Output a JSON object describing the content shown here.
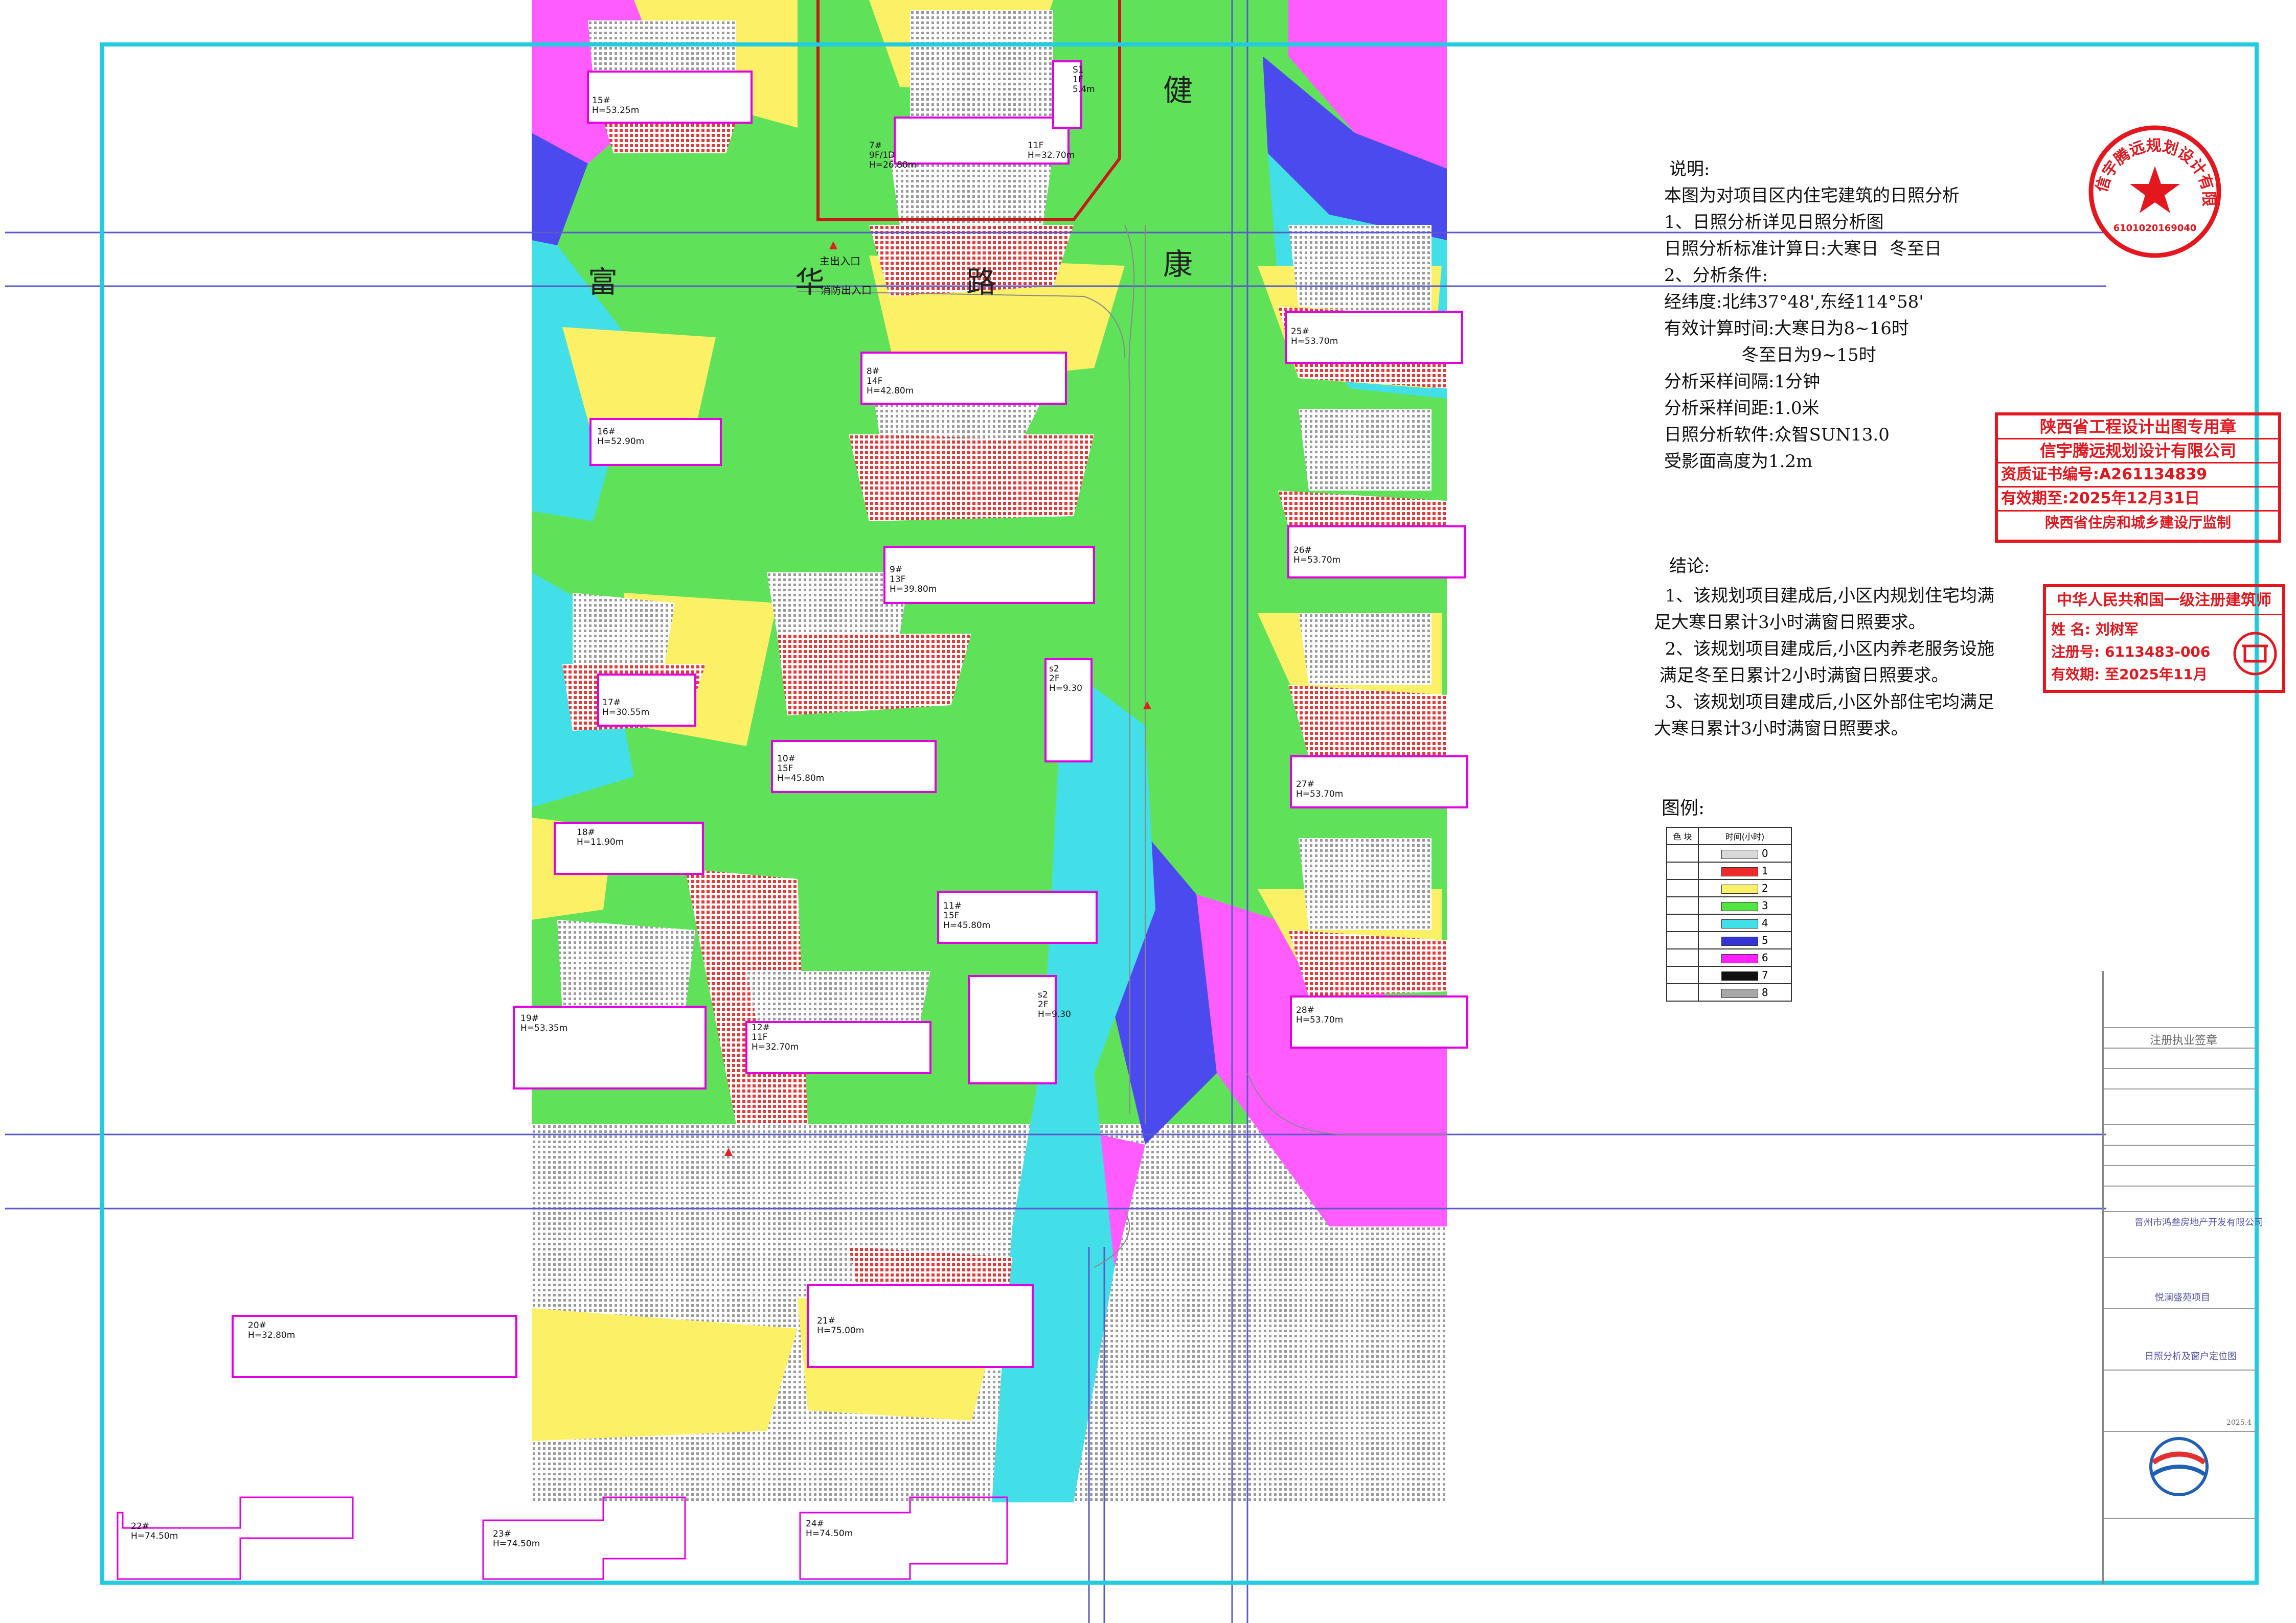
{
  "colors": {
    "frame": "#22cbe0",
    "red": "#ee2b2b",
    "yellow": "#fbf066",
    "green": "#52e542",
    "cyan": "#3fe0e8",
    "blue": "#4343ec",
    "magenta": "#ff1fff",
    "black": "#111111",
    "grey": "#bdbdbd",
    "stamp_red": "#e4161e"
  },
  "notes": {
    "heading": "说明:",
    "lines": [
      "本图为对项目区内住宅建筑的日照分析",
      "1、日照分析详见日照分析图",
      "日照分析标准计算日:大寒日  冬至日",
      "2、分析条件:",
      "经纬度:北纬37°48',东经114°58'",
      "有效计算时间:大寒日为8~16时",
      "              冬至日为9~15时",
      "分析采样间隔:1分钟",
      "分析采样间距:1.0米",
      "日照分析软件:众智SUN13.0",
      "受影面高度为1.2m"
    ]
  },
  "conclusion": {
    "heading": "结论:",
    "lines": [
      "  1、该规划项目建成后,小区内规划住宅均满",
      "足大寒日累计3小时满窗日照要求。",
      "  2、该规划项目建成后,小区内养老服务设施",
      " 满足冬至日累计2小时满窗日照要求。",
      "  3、该规划项目建成后,小区外部住宅均满足",
      "大寒日累计3小时满窗日照要求。"
    ]
  },
  "legend": {
    "title": "图例:",
    "header_color": "色 块",
    "header_time": "时间(小时)",
    "rows": [
      {
        "label": "0",
        "color": "#d9d9d9"
      },
      {
        "label": "1",
        "color": "#ee2b2b"
      },
      {
        "label": "2",
        "color": "#fbf066"
      },
      {
        "label": "3",
        "color": "#52e542"
      },
      {
        "label": "4",
        "color": "#3fe0e8"
      },
      {
        "label": "5",
        "color": "#3434d6"
      },
      {
        "label": "6",
        "color": "#ff1fff"
      },
      {
        "label": "7",
        "color": "#111111"
      },
      {
        "label": "8",
        "color": "#a8a8a8"
      }
    ]
  },
  "roads": {
    "fuhua": [
      "富",
      "华",
      "路"
    ],
    "jiankang": [
      "健",
      "康"
    ]
  },
  "entrances": {
    "main": "主出入口",
    "fire": "消防出入口"
  },
  "buildings": [
    {
      "name": "15#",
      "height": "H=53.25m"
    },
    {
      "name": "16#",
      "height": "H=52.90m"
    },
    {
      "name": "17#",
      "height": "H=30.55m"
    },
    {
      "name": "18#",
      "height": "H=11.90m"
    },
    {
      "name": "19#",
      "height": "H=53.35m"
    },
    {
      "name": "20#",
      "height": "H=32.80m"
    },
    {
      "name": "21#",
      "height": "H=75.00m"
    },
    {
      "name": "22#",
      "height": "H=74.50m"
    },
    {
      "name": "23#",
      "height": "H=74.50m"
    },
    {
      "name": "24#",
      "height": "H=74.50m"
    },
    {
      "name": "25#",
      "height": "H=53.70m"
    },
    {
      "name": "26#",
      "height": "H=53.70m"
    },
    {
      "name": "27#",
      "height": "H=53.70m"
    },
    {
      "name": "28#",
      "height": "H=53.70m"
    },
    {
      "name": "7#",
      "floors": "9F/1D",
      "height": "H=26.80m"
    },
    {
      "name": "8#",
      "floors": "14F",
      "height": "H=42.80m"
    },
    {
      "name": "9#",
      "floors": "13F",
      "height": "H=39.80m"
    },
    {
      "name": "10#",
      "floors": "15F",
      "height": "H=45.80m"
    },
    {
      "name": "11#",
      "floors": "15F",
      "height": "H=45.80m"
    },
    {
      "name": "12#",
      "floors": "11F",
      "height": "H=32.70m"
    },
    {
      "name": "S1",
      "floors": "1F",
      "height": "5.4m"
    },
    {
      "name": "s2",
      "floors": "2F",
      "height": "H=9.30"
    },
    {
      "name": "s2",
      "floors": "2F",
      "height": "H=9.30"
    },
    {
      "name": "11F",
      "floors": "",
      "height": "H=32.70m"
    }
  ],
  "stamp_round": {
    "text": "信宇腾远规划设计有限公司",
    "code": "6101020169040"
  },
  "stamp_design": {
    "line1": "陕西省工程设计出图专用章",
    "line2": "信宇腾远规划设计有限公司",
    "line3": "资质证书编号:A261134839",
    "line4": "有效期至:2025年12月31日",
    "line5": "陕西省住房和城乡建设厅监制"
  },
  "stamp_architect": {
    "line1": "中华人民共和国一级注册建筑师",
    "name_label": "姓  名:",
    "name": "刘树军",
    "reg_label": "注册号:",
    "reg": "6113483-006",
    "valid_label": "有效期:",
    "valid": "至2025年11月"
  },
  "title_block": {
    "sign_header": "注册执业签章",
    "client": "晋州市鸿叁房地产开发有限公司",
    "project": "悦澜盛苑项目",
    "drawing": "日照分析及窗户定位图",
    "date": "2025.4"
  }
}
